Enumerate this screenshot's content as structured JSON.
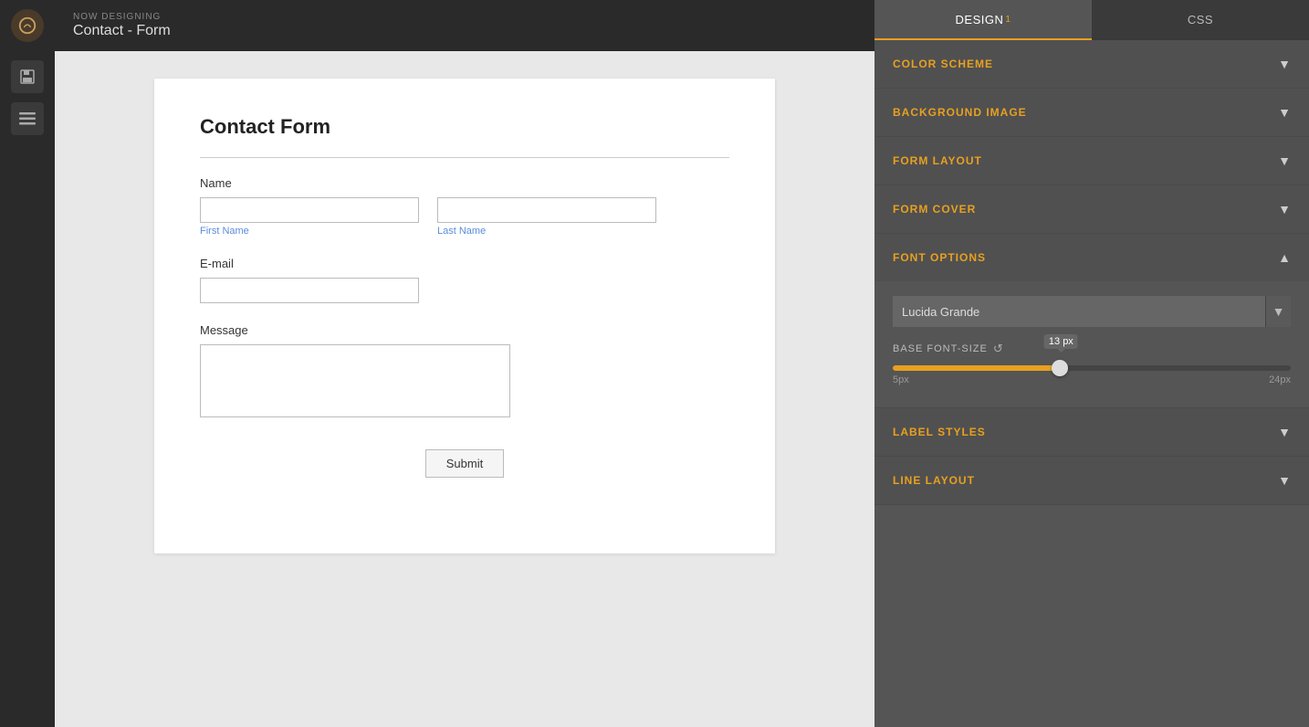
{
  "app": {
    "now_designing_label": "NOW DESIGNING",
    "page_title": "Contact - Form"
  },
  "sidebar": {
    "items": [
      {
        "name": "logo",
        "icon": "◎"
      },
      {
        "name": "save",
        "icon": "💾"
      },
      {
        "name": "menu",
        "icon": "☰"
      }
    ]
  },
  "form": {
    "title": "Contact Form",
    "fields": {
      "name_label": "Name",
      "first_name_label": "First Name",
      "last_name_label": "Last Name",
      "email_label": "E-mail",
      "message_label": "Message"
    },
    "submit_button": "Submit"
  },
  "panel": {
    "tabs": [
      {
        "id": "design",
        "label": "DESIGN",
        "active": true
      },
      {
        "id": "css",
        "label": "CSS",
        "active": false
      }
    ],
    "sections": [
      {
        "id": "color-scheme",
        "label": "COLOR SCHEME",
        "open": false
      },
      {
        "id": "background-image",
        "label": "BACKGROUND IMAGE",
        "open": false
      },
      {
        "id": "form-layout",
        "label": "FORM LAYOUT",
        "open": false
      },
      {
        "id": "form-cover",
        "label": "FORM COVER",
        "open": false
      },
      {
        "id": "font-options",
        "label": "FONT OPTIONS",
        "open": true
      },
      {
        "id": "label-styles",
        "label": "LABEL STYLES",
        "open": false
      },
      {
        "id": "line-layout",
        "label": "LINE LAYOUT",
        "open": false
      }
    ],
    "font_options": {
      "font_family": "Lucida Grande",
      "font_select_arrow": "▼",
      "base_font_size_label": "BASE FONT-SIZE",
      "reset_icon": "↺",
      "slider_min": "5px",
      "slider_max": "24px",
      "slider_value": "13 px",
      "slider_percent": 42
    }
  }
}
